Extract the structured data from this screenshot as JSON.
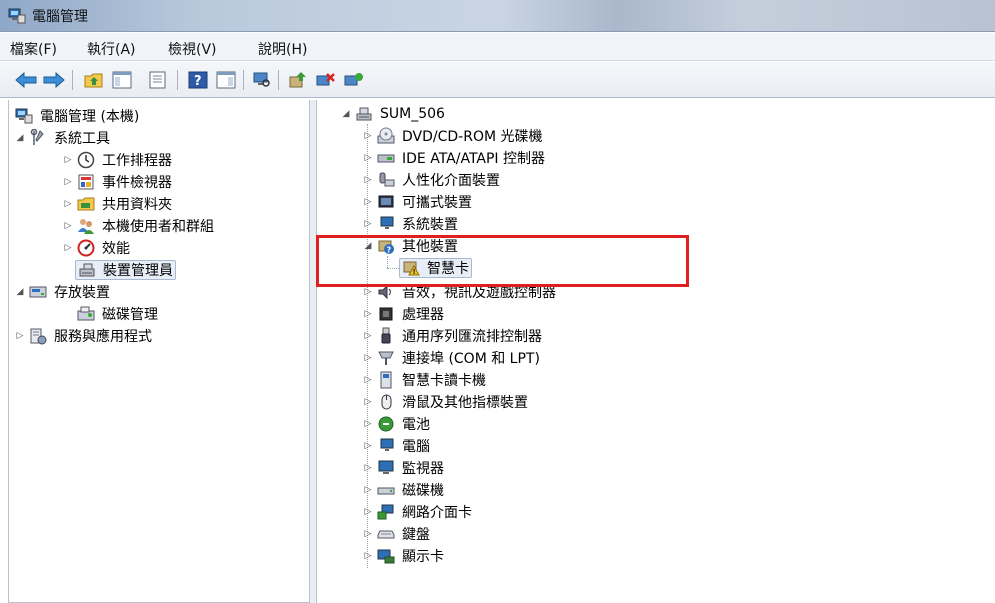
{
  "window": {
    "title": "電腦管理"
  },
  "menu": [
    "檔案(F)",
    "執行(A)",
    "檢視(V)",
    "說明(H)"
  ],
  "toolbar": {
    "buttons": [
      "back-icon",
      "forward-icon",
      "up-folder-icon",
      "show-hide-tree-icon",
      "properties-icon",
      "help-icon",
      "action-pane-icon",
      "scan-hardware-icon",
      "update-driver-icon",
      "uninstall-icon",
      "enable-device-icon"
    ]
  },
  "left_tree": {
    "root": "電腦管理 (本機)",
    "system_tools": "系統工具",
    "task_scheduler": "工作排程器",
    "event_viewer": "事件檢視器",
    "shared_folders": "共用資料夾",
    "local_users": "本機使用者和群組",
    "performance": "效能",
    "device_manager": "裝置管理員",
    "storage": "存放裝置",
    "disk_management": "磁碟管理",
    "services_apps": "服務與應用程式"
  },
  "right_tree": {
    "computer_name": "SUM_506",
    "devices": [
      "DVD/CD-ROM 光碟機",
      "IDE ATA/ATAPI 控制器",
      "人性化介面裝置",
      "可攜式裝置",
      "系統裝置",
      "其他裝置",
      "智慧卡",
      "音效，視訊及遊戲控制器",
      "處理器",
      "通用序列匯流排控制器",
      "連接埠 (COM 和 LPT)",
      "智慧卡讀卡機",
      "滑鼠及其他指標裝置",
      "電池",
      "電腦",
      "監視器",
      "磁碟機",
      "網路介面卡",
      "鍵盤",
      "顯示卡"
    ]
  },
  "colors": {
    "highlight": "#e0201e",
    "selection": "#e8eef7"
  }
}
